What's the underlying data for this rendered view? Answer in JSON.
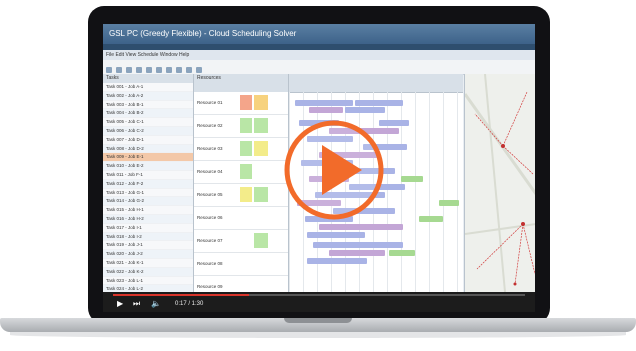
{
  "window": {
    "title": "GSL PC (Greedy Flexible) - Cloud Scheduling Solver",
    "menu": "File  Edit  View  Schedule  Window  Help"
  },
  "colors": {
    "play_accent": "#f26b2a",
    "progress": "#d8342a",
    "selected_row": "#f3c8a8"
  },
  "left_panel": {
    "header": "Tasks",
    "rows": [
      "Task 001 - Job A-1",
      "Task 002 - Job A-2",
      "Task 003 - Job B-1",
      "Task 004 - Job B-2",
      "Task 005 - Job C-1",
      "Task 006 - Job C-2",
      "Task 007 - Job D-1",
      "Task 008 - Job D-2",
      "Task 009 - Job E-1",
      "Task 010 - Job E-2",
      "Task 011 - Job F-1",
      "Task 012 - Job F-2",
      "Task 013 - Job G-1",
      "Task 014 - Job G-2",
      "Task 015 - Job H-1",
      "Task 016 - Job H-2",
      "Task 017 - Job I-1",
      "Task 018 - Job I-2",
      "Task 019 - Job J-1",
      "Task 020 - Job J-2",
      "Task 021 - Job K-1",
      "Task 022 - Job K-2",
      "Task 023 - Job L-1",
      "Task 024 - Job L-2",
      "Task 025 - Job M-1"
    ]
  },
  "mid_panel": {
    "header": "Resources",
    "rows": [
      {
        "name": "Resource 01",
        "c1": "#f4a58a",
        "c2": "#f7d27e"
      },
      {
        "name": "Resource 02",
        "c1": "#b9e6a6",
        "c2": "#b9e6a6"
      },
      {
        "name": "Resource 03",
        "c1": "#b9e6a6",
        "c2": "#f3ec8a"
      },
      {
        "name": "Resource 04",
        "c1": "#b9e6a6",
        "c2": "#ffffff"
      },
      {
        "name": "Resource 05",
        "c1": "#f3ec8a",
        "c2": "#b9e6a6"
      },
      {
        "name": "Resource 06",
        "c1": "#ffffff",
        "c2": "#ffffff"
      },
      {
        "name": "Resource 07",
        "c1": "#ffffff",
        "c2": "#b9e6a6"
      },
      {
        "name": "Resource 08",
        "c1": "#ffffff",
        "c2": "#ffffff"
      },
      {
        "name": "Resource 09",
        "c1": "#ffffff",
        "c2": "#ffffff"
      }
    ]
  },
  "player": {
    "time": "0:17 / 1:30",
    "progress": 0.33
  }
}
